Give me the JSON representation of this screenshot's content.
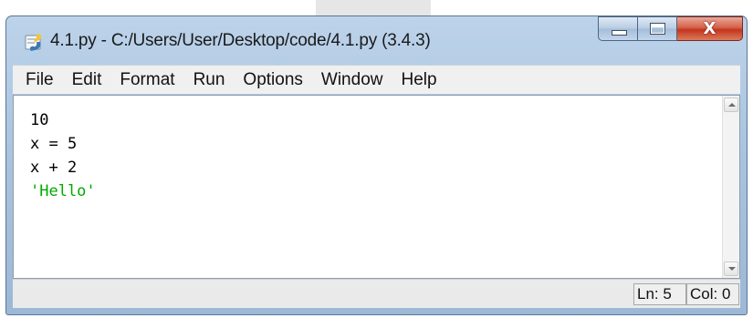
{
  "window": {
    "title": "4.1.py - C:/Users/User/Desktop/code/4.1.py (3.4.3)",
    "close_glyph": "X"
  },
  "menu": {
    "items": [
      "File",
      "Edit",
      "Format",
      "Run",
      "Options",
      "Window",
      "Help"
    ]
  },
  "editor": {
    "lines": [
      {
        "text": "10",
        "kind": "plain"
      },
      {
        "text": "x = 5",
        "kind": "plain"
      },
      {
        "text": "x + 2",
        "kind": "plain"
      },
      {
        "text": "'Hello'",
        "kind": "string"
      }
    ],
    "colors": {
      "plain": "#000000",
      "string": "#00aa00"
    }
  },
  "status": {
    "line": "Ln: 5",
    "column": "Col: 0"
  },
  "icons": {
    "app": "idle-python-icon",
    "minimize": "minimize-icon",
    "maximize": "maximize-icon",
    "close": "close-icon",
    "scroll_up": "scroll-up-arrow-icon",
    "scroll_down": "scroll-down-arrow-icon"
  }
}
